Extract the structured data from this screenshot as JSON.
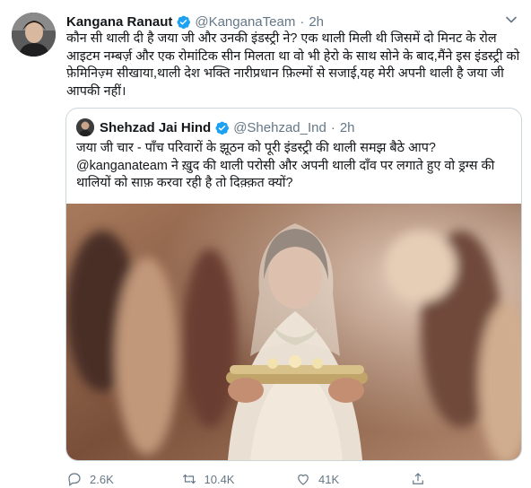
{
  "tweet": {
    "author_name": "Kangana Ranaut",
    "handle": "@KanganaTeam",
    "separator": "·",
    "time": "2h",
    "text": "कौन सी थाली दी है जया जी और उनकी इंडस्ट्री ने? एक थाली मिली थी जिसमें दो मिनट के रोल आइटम नम्बर्ज़ और एक रोमांटिक सीन मिलता था वो भी हेरो के साथ सोने के बाद,मैंने इस इंडस्ट्री को फ़ेमिनिज़्म सीखाया,थाली देश भक्ति नारीप्रधान फ़िल्मों से सजाई,यह मेरी अपनी थाली है जया जी आपकी नहीं।"
  },
  "quoted": {
    "author_name": "Shehzad Jai Hind",
    "handle": "@Shehzad_Ind",
    "separator": "·",
    "time": "2h",
    "text": "जया जी चार - पाँच परिवारों के झूठन को पूरी इंडस्ट्री की थाली समझ बैठे आप? @kanganateam ने ख़ुद की थाली परोसी और अपनी थाली दाँव पर लगाते हुए वो ड्रग्स की थालियों को साफ़ करवा रही है तो दिक़्क़त क्यों?"
  },
  "actions": {
    "reply_count": "2.6K",
    "retweet_count": "10.4K",
    "like_count": "41K"
  },
  "icons": [
    "verified-badge-icon",
    "chevron-down-icon",
    "reply-icon",
    "retweet-icon",
    "like-icon",
    "share-icon"
  ],
  "colors": {
    "verified": "#1da1f2",
    "muted": "#657786",
    "border": "#ccd6dd",
    "text": "#14171a"
  }
}
